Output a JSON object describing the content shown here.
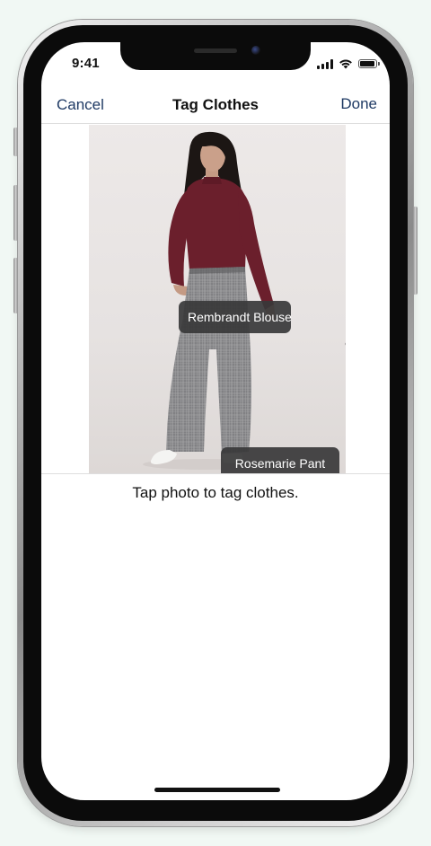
{
  "status_bar": {
    "time": "9:41",
    "signal_icon": "cellular-signal-icon",
    "wifi_icon": "wifi-icon",
    "battery_icon": "battery-icon",
    "battery_level": 0.95
  },
  "nav": {
    "cancel_label": "Cancel",
    "title": "Tag Clothes",
    "done_label": "Done"
  },
  "photo": {
    "tags": [
      {
        "label": "Rembrandt Blouse"
      },
      {
        "label": "Rosemarie Pant"
      }
    ],
    "cursor_icon": "hand-pointer-icon"
  },
  "hint": "Tap photo to tag clothes.",
  "colors": {
    "accent": "#1f3a64",
    "tag_background": "#38383a",
    "page_background": "#f1f8f4"
  }
}
